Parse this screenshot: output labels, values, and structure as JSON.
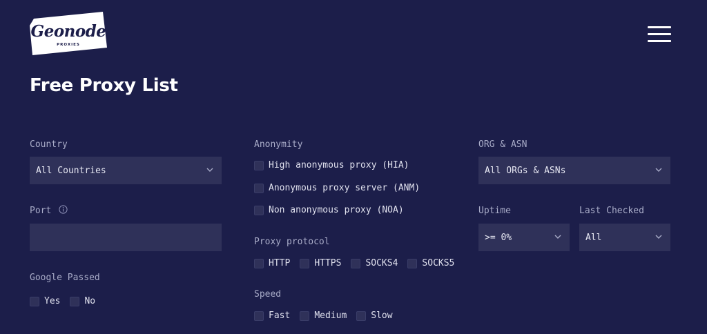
{
  "header": {
    "logo_text": "Geonode",
    "logo_sub": "PROXIES",
    "menu_icon": "hamburger-icon"
  },
  "page_title": "Free Proxy List",
  "filters": {
    "country": {
      "label": "Country",
      "value": "All Countries"
    },
    "port": {
      "label": "Port",
      "value": "",
      "placeholder": ""
    },
    "google_passed": {
      "label": "Google Passed",
      "options": [
        "Yes",
        "No"
      ]
    },
    "anonymity": {
      "label": "Anonymity",
      "options": [
        "High anonymous proxy (HIA)",
        "Anonymous proxy server (ANM)",
        "Non anonymous proxy (NOA)"
      ]
    },
    "proxy_protocol": {
      "label": "Proxy protocol",
      "options": [
        "HTTP",
        "HTTPS",
        "SOCKS4",
        "SOCKS5"
      ]
    },
    "speed": {
      "label": "Speed",
      "options": [
        "Fast",
        "Medium",
        "Slow"
      ]
    },
    "org_asn": {
      "label": "ORG & ASN",
      "value": "All ORGs & ASNs"
    },
    "uptime": {
      "label": "Uptime",
      "value": ">= 0%"
    },
    "last_checked": {
      "label": "Last Checked",
      "value": "All"
    }
  },
  "colors": {
    "background": "#1c1e4a",
    "field": "#2f3159",
    "text": "#ffffff"
  }
}
